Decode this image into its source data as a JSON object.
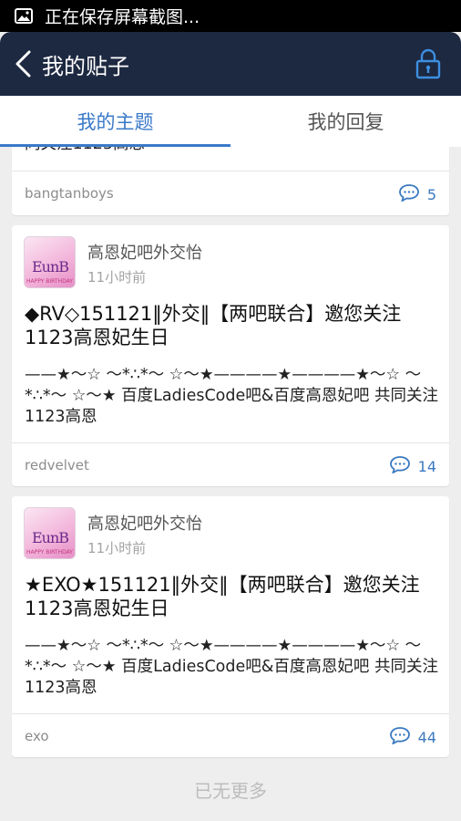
{
  "status_bar": {
    "text": "正在保存屏幕截图..."
  },
  "header": {
    "title": "我的贴子",
    "back_icon": "chevron-left-icon",
    "lock_icon": "lock-icon"
  },
  "tabs": [
    {
      "label": "我的主题",
      "active": true
    },
    {
      "label": "我的回复",
      "active": false
    }
  ],
  "posts": [
    {
      "partial_text": "同关注1123高恩",
      "tag": "bangtanboys",
      "comments": "5"
    },
    {
      "author": "高恩妃吧外交怡",
      "time": "11小时前",
      "title": "◆RV◇151121‖外交‖【两吧联合】邀您关注1123高恩妃生日",
      "body": "——★～☆ ～*∴*～ ☆～★————★————★～☆ ～*∴*～ ☆～★ 百度LadiesCode吧&百度高恩妃吧 共同关注1123高恩",
      "tag": "redvelvet",
      "comments": "14"
    },
    {
      "author": "高恩妃吧外交怡",
      "time": "11小时前",
      "title": "★EXO★151121‖外交‖【两吧联合】邀您关注1123高恩妃生日",
      "body": "——★～☆ ～*∴*～ ☆～★————★————★～☆ ～*∴*～ ☆～★ 百度LadiesCode吧&百度高恩妃吧 共同关注1123高恩",
      "tag": "exo",
      "comments": "44"
    }
  ],
  "avatar_text": {
    "mono": "EunB",
    "tiny": "HAPPY BIRTHDAY"
  },
  "footer": {
    "no_more": "已无更多"
  },
  "colors": {
    "header_bg": "#1d2841",
    "accent": "#3a79c8"
  }
}
